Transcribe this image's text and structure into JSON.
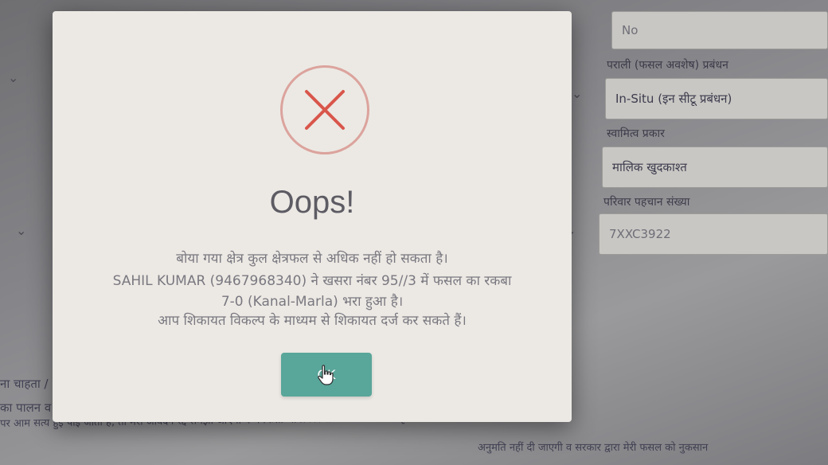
{
  "form": {
    "top_field_value": "No",
    "residue_label": "पराली (फसल अवशेष) प्रबंधन",
    "residue_value": "In-Situ (इन सीटू प्रबंधन)",
    "ownership_label": "स्वामित्व प्रकार",
    "ownership_value": "मालिक खुदकाश्त",
    "family_id_label": "परिवार पहचान संख्या",
    "family_id_value": "7XXC3922",
    "left_fragment_1": "ना चाहता /",
    "left_fragment_2": "का पालन व",
    "declaration_line_1": "पर आम सत्य हुई पाइ जाती है, तो मेरा आवेदन रद्द समझा जाएगा व मैं किसी भी प्रकार से फसल प्रबंधन या कृषि विभाग द्वारा संचालित अन्य योजना",
    "declaration_line_2": "अनुमति नहीं दी जाएगी व सरकार द्वारा मेरी फसल को नुकसान"
  },
  "dialog": {
    "icon": "error-x-icon",
    "title": "Oops!",
    "message_lines": [
      "बोया गया क्षेत्र कुल क्षेत्रफल से अधिक नहीं हो सकता है।",
      "SAHIL KUMAR (9467968340) ने खसरा नंबर 95//3 में फसल का रकबा",
      "7-0 (Kanal-Marla) भरा हुआ है।",
      "आप शिकायत विकल्प के माध्यम से शिकायत दर्ज कर सकते हैं।"
    ],
    "ok_label": "OK",
    "cursor_icon": "hand-pointer-icon"
  },
  "colors": {
    "ok_button": "#59a69a",
    "error_ring": "#dca39d",
    "error_x": "#d9564b"
  }
}
